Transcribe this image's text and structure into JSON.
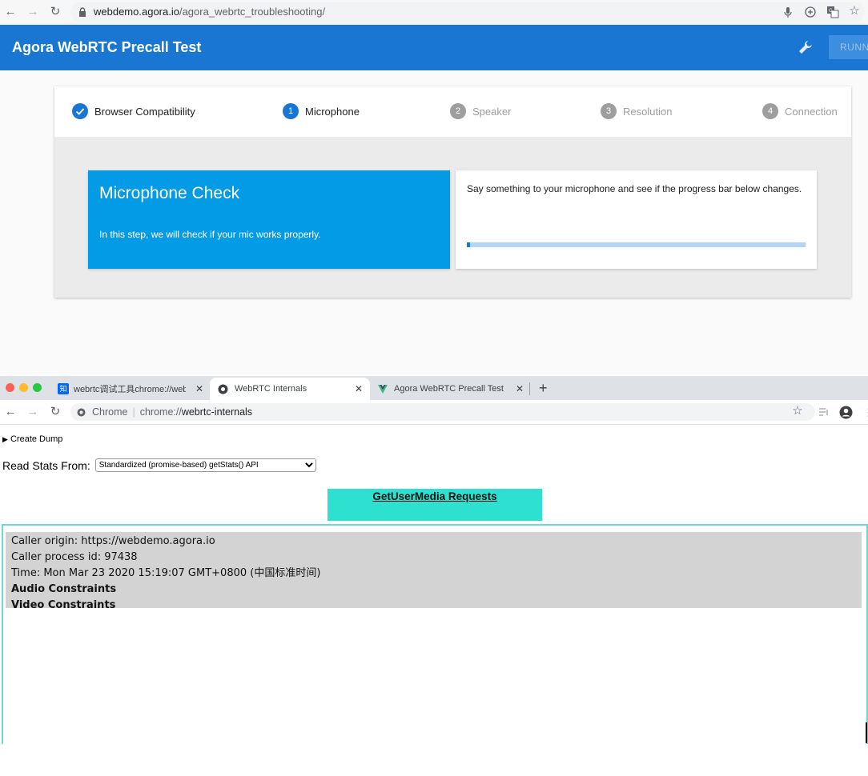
{
  "top_browser": {
    "url_host": "webdemo.agora.io",
    "url_path": "/agora_webrtc_troubleshooting/"
  },
  "app": {
    "title": "Agora WebRTC Precall Test",
    "run_button": "RUNN",
    "accent_color": "#1976d2"
  },
  "stepper": {
    "steps": [
      {
        "num": "",
        "label": "Browser Compatibility",
        "state": "done"
      },
      {
        "num": "1",
        "label": "Microphone",
        "state": "active"
      },
      {
        "num": "2",
        "label": "Speaker",
        "state": "pending"
      },
      {
        "num": "3",
        "label": "Resolution",
        "state": "pending"
      },
      {
        "num": "4",
        "label": "Connection",
        "state": "pending"
      }
    ]
  },
  "mic_check": {
    "title": "Microphone Check",
    "description": "In this step, we will check if your mic works properly.",
    "instruction": "Say something to your microphone and see if the progress bar below changes.",
    "level_percent": 1
  },
  "second_browser": {
    "tabs": [
      {
        "label": "webrtc调试工具chrome://webr",
        "favicon": "知"
      },
      {
        "label": "WebRTC Internals"
      },
      {
        "label": "Agora WebRTC Precall Test"
      }
    ],
    "url_scheme_label": "Chrome",
    "url_prefix": "chrome://",
    "url_host": "webrtc-internals"
  },
  "internals": {
    "create_dump": "Create Dump",
    "read_stats_label": "Read Stats From:",
    "read_stats_selected": "Standardized (promise-based) getStats() API",
    "gum_tab": "GetUserMedia Requests",
    "entry": {
      "caller_origin": "Caller origin: https://webdemo.agora.io",
      "caller_process": "Caller process id: 97438",
      "time": "Time: Mon Mar 23 2020 15:19:07 GMT+0800 (中国标准时间)",
      "audio": "Audio Constraints",
      "video": "Video Constraints"
    }
  }
}
